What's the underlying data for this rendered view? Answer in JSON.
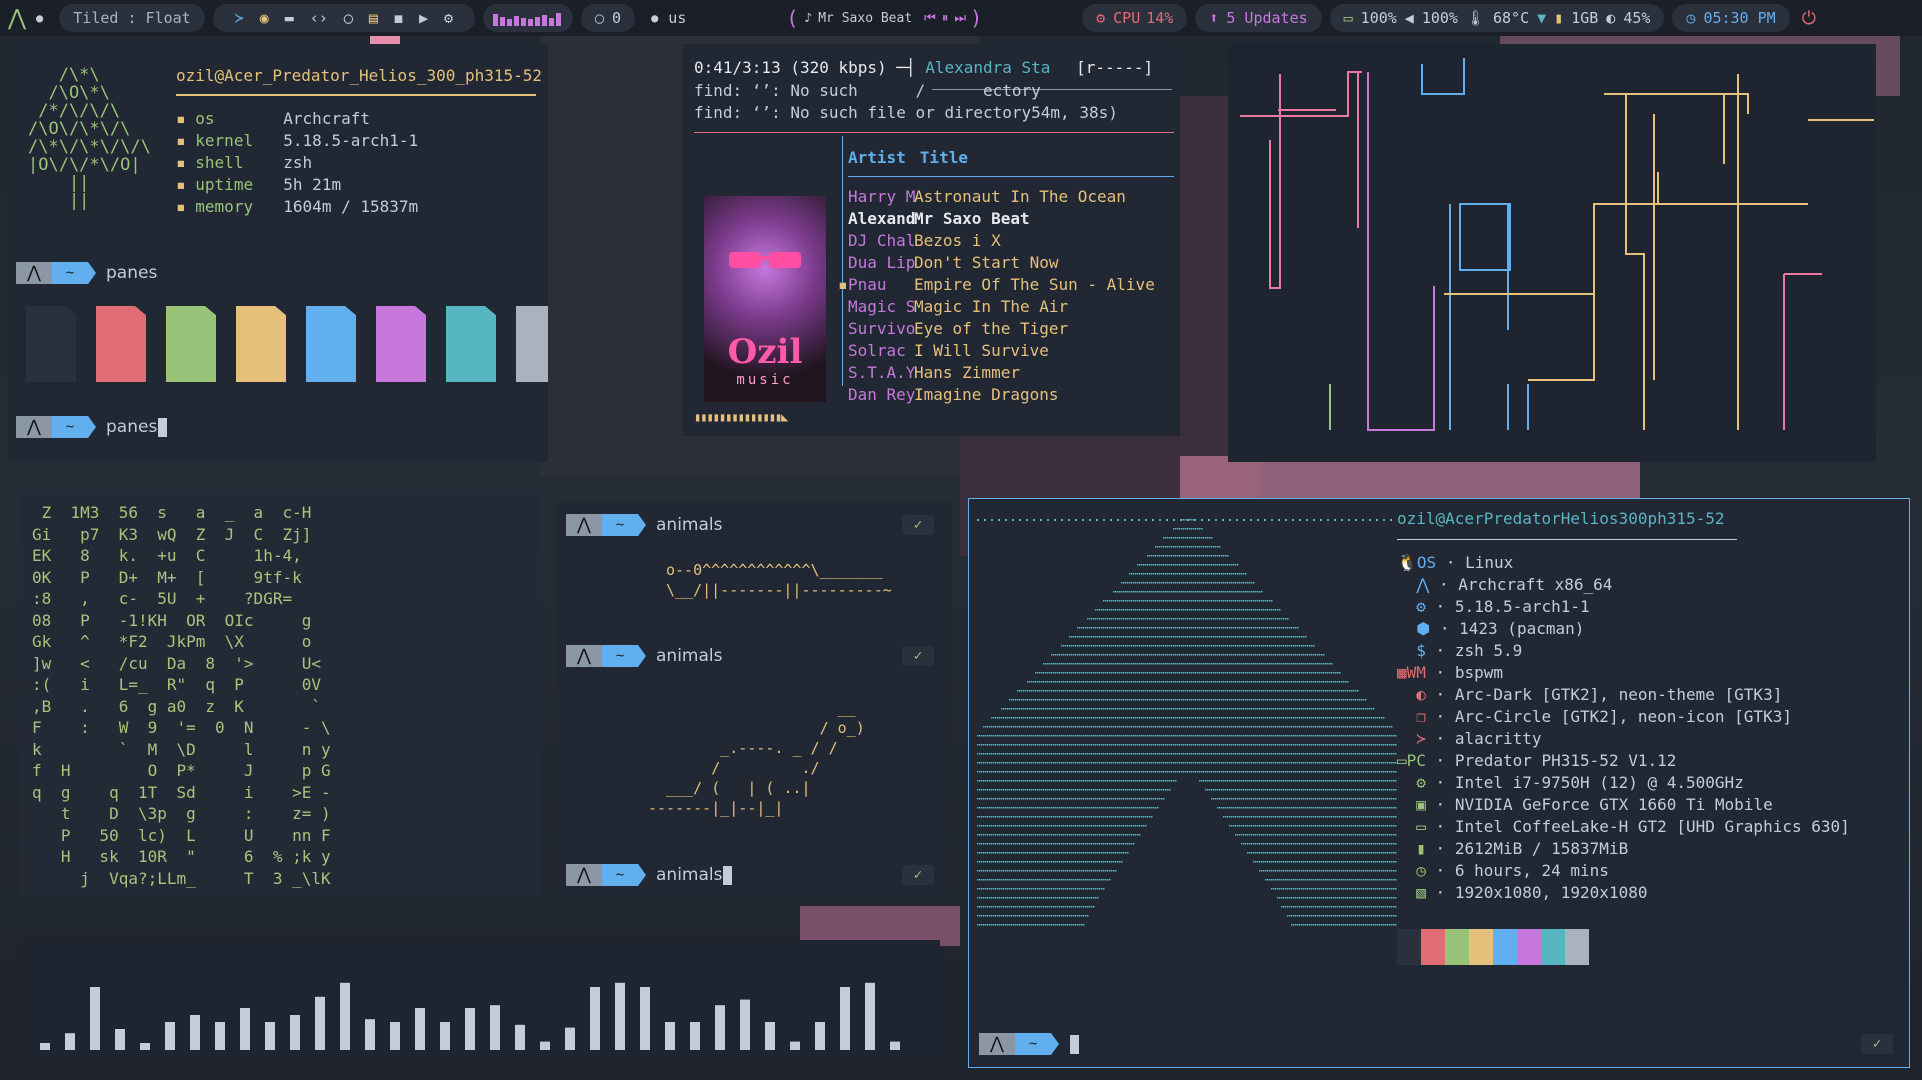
{
  "colors": {
    "bg": "#1b2028",
    "panel": "#212733",
    "pill": "#2b313c",
    "green": "#98c379",
    "yellow": "#e5c07b",
    "blue": "#61afef",
    "red": "#e06c75",
    "magenta": "#c678dd",
    "cyan": "#56b6c2",
    "gray": "#abb2bf",
    "fg": "#c6ccd7"
  },
  "topbar": {
    "layout": "Tiled : Float",
    "launcher_icons": [
      "terminal-icon",
      "firefox-icon",
      "folder-icon",
      "code-icon",
      "github-icon",
      "notes-icon",
      "chat-icon",
      "youtube-icon",
      "settings-icon"
    ],
    "github_count": "0",
    "keyboard": "us",
    "now_playing": "Mr Saxo Beat",
    "cpu_label": "CPU",
    "cpu_value": "14%",
    "updates": "5 Updates",
    "battery": "100%",
    "volume": "100%",
    "temp": "68°C",
    "memory": "1GB",
    "brightness": "45%",
    "time": "05:30 PM"
  },
  "fetch1": {
    "user_host": "ozil@Acer_Predator_Helios_300_ph315-52",
    "art": "   /\\*\\\n  /\\O\\*\\\n /*/\\/\\/\\\n/\\O\\/\\*\\/\\\n/\\*\\/\\*\\/\\/\\\n|O\\/\\/*\\/O|\n    ||\n    ||",
    "rows": [
      {
        "key": "os",
        "val": "Archcraft"
      },
      {
        "key": "kernel",
        "val": "5.18.5-arch1-1"
      },
      {
        "key": "shell",
        "val": "zsh"
      },
      {
        "key": "uptime",
        "val": "5h 21m"
      },
      {
        "key": "memory",
        "val": "1604m / 15837m"
      }
    ],
    "prompt1": "panes",
    "prompt2": "panes",
    "swatches": [
      "#2b313c",
      "#e06c75",
      "#98c379",
      "#e5c07b",
      "#61afef",
      "#c678dd",
      "#56b6c2",
      "#abb2bf"
    ]
  },
  "prompt_home": "~",
  "prompt_check": "✓",
  "music": {
    "status": "0:41/3:13 (320 kbps) ─┤",
    "artist_header": "Alexandra Sta",
    "mode": "[r-----]",
    "find1": "find: ‘’: No such      /      ectory",
    "find2": "find: ‘’: No such file or directory54m, 38s)",
    "col_artist": "Artist",
    "col_title": "Title",
    "album_text": "Ozil",
    "album_sub": "music",
    "tracks": [
      {
        "artist": "Harry M",
        "title": "Astronaut In The Ocean"
      },
      {
        "artist": "Alexand",
        "title": "Mr Saxo Beat"
      },
      {
        "artist": "DJ Chal",
        "title": "Bezos i X"
      },
      {
        "artist": "Dua Lip",
        "title": "Don't Start Now"
      },
      {
        "artist": "Pnau",
        "title": "Empire Of The Sun - Alive"
      },
      {
        "artist": "Magic S",
        "title": "Magic In The Air"
      },
      {
        "artist": "Survivo",
        "title": "Eye of the Tiger"
      },
      {
        "artist": "Solrac",
        "title": "I Will Survive"
      },
      {
        "artist": "S.T.A.Y",
        "title": "Hans Zimmer"
      },
      {
        "artist": "Dan Rey",
        "title": "Imagine Dragons"
      }
    ],
    "progress_bar": "▮▮▮▮▮▮▮▮▮▮▮▮▮▮◣"
  },
  "matrix": {
    "lines": [
      " Z  1M3  56  s   a  _  a  c-H",
      "Gi   p7  K3  wQ  Z  J  C  Zj]",
      "EK   8   k.  +u  C     1h-4,",
      "0K   P   D+  M+  [     9tf-k",
      ":8   ,   c-  5U  +    ?DGR=",
      "08   P   -1!KH  OR  OIc     g",
      "Gk   ^   *F2  JkPm  \\X      o",
      "]w   <   /cu  Da  8  '>     U<",
      ":(   i   L=_  R\"  q  P      0V",
      ",B   .   6  g a0  z  K       `",
      "F    :   W  9  '=  0  N     - \\",
      "k        `  M  \\D     l     n y",
      "f  H        O  P*     J     p G",
      "q  g    q  1T  Sd     i    >E -",
      "   t    D  \\3p  g     :    z= )",
      "   P   50  lc)  L     U    nn F",
      "   H   sk  10R  \"     6  % ;k y",
      "     j  Vqa?;LLm_     T  3 _\\lK"
    ]
  },
  "animals": {
    "prompt1": "animals",
    "art1": "o--0^^^^^^^^^^^^\\_______\n\\__/||-------||---------~",
    "prompt2": "animals",
    "art2": "                     __\n                   / o_)\n        _.----. _ / /\n       /         ./\n  ___/ (   | ( ..|\n-------|_|--|_|",
    "prompt3": "animals"
  },
  "visualizer": {
    "bars": [
      0.05,
      0.12,
      0.45,
      0.15,
      0.05,
      0.2,
      0.25,
      0.2,
      0.3,
      0.2,
      0.25,
      0.38,
      0.48,
      0.22,
      0.2,
      0.3,
      0.2,
      0.3,
      0.32,
      0.18,
      0.06,
      0.16,
      0.45,
      0.48,
      0.45,
      0.2,
      0.2,
      0.32,
      0.36,
      0.2,
      0.06,
      0.2,
      0.45,
      0.48,
      0.06
    ]
  },
  "fetch2": {
    "user_host": "ozil@AcerPredatorHelios300ph315-52",
    "sections": [
      {
        "icon": "linux-icon",
        "label": "OS",
        "val": "Linux",
        "color": "#61afef"
      },
      {
        "icon": "arch-icon",
        "label": "",
        "val": "Archcraft x86_64",
        "color": "#61afef"
      },
      {
        "icon": "gear-icon",
        "label": "",
        "val": "5.18.5-arch1-1",
        "color": "#61afef"
      },
      {
        "icon": "package-icon",
        "label": "",
        "val": "1423 (pacman)",
        "color": "#61afef"
      },
      {
        "icon": "shell-icon",
        "label": "",
        "val": "zsh 5.9",
        "color": "#61afef"
      },
      {
        "icon": "window-icon",
        "label": "WM",
        "val": "bspwm",
        "color": "#e06c75"
      },
      {
        "icon": "palette-icon",
        "label": "",
        "val": "Arc-Dark [GTK2], neon-theme [GTK3]",
        "color": "#e06c75"
      },
      {
        "icon": "icons-icon",
        "label": "",
        "val": "Arc-Circle [GTK2], neon-icon [GTK3]",
        "color": "#e06c75"
      },
      {
        "icon": "terminal-icon",
        "label": "",
        "val": "alacritty",
        "color": "#e06c75"
      },
      {
        "icon": "laptop-icon",
        "label": "PC",
        "val": "Predator PH315-52 V1.12",
        "color": "#98c379"
      },
      {
        "icon": "cpu-icon",
        "label": "",
        "val": "Intel i7-9750H (12) @ 4.500GHz",
        "color": "#98c379"
      },
      {
        "icon": "gpu-icon",
        "label": "",
        "val": "NVIDIA GeForce GTX 1660 Ti Mobile",
        "color": "#98c379"
      },
      {
        "icon": "monitor-icon",
        "label": "",
        "val": "Intel CoffeeLake-H GT2 [UHD Graphics 630]",
        "color": "#98c379"
      },
      {
        "icon": "memory-icon",
        "label": "",
        "val": "2612MiB / 15837MiB",
        "color": "#98c379"
      },
      {
        "icon": "clock-icon",
        "label": "",
        "val": "6 hours, 24 mins",
        "color": "#98c379"
      },
      {
        "icon": "display-icon",
        "label": "",
        "val": "1920x1080, 1920x1080",
        "color": "#98c379"
      }
    ],
    "swatches": [
      "#2b313c",
      "#e06c75",
      "#98c379",
      "#e5c07b",
      "#61afef",
      "#c678dd",
      "#56b6c2",
      "#abb2bf"
    ]
  }
}
